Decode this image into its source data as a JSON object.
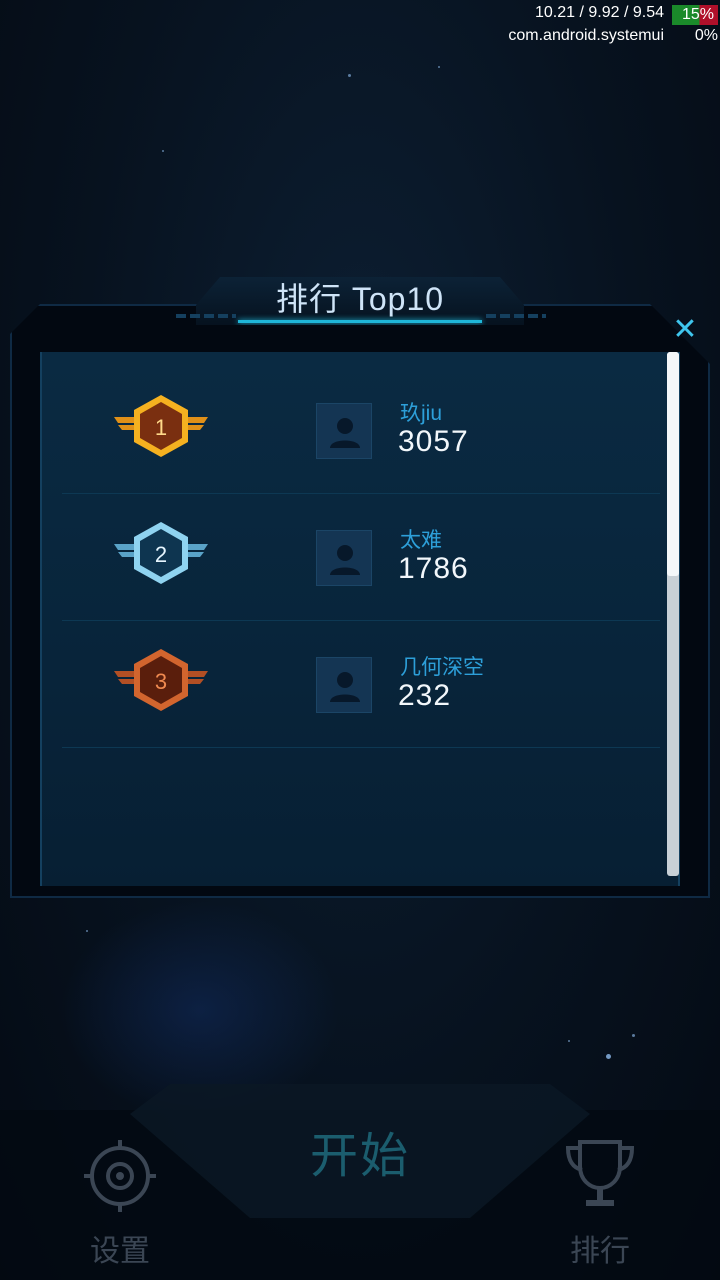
{
  "status_overlay": {
    "cpu_freqs": "10.21 / 9.92 / 9.54",
    "battery": "15%",
    "process": "com.android.systemui",
    "process_pct": "0%"
  },
  "leaderboard": {
    "title": "排行 Top10",
    "close_symbol": "✕",
    "entries": [
      {
        "rank": "1",
        "name": "玖jiu",
        "score": "3057",
        "medal_color": "#f2a41c"
      },
      {
        "rank": "2",
        "name": "太难",
        "score": "1786",
        "medal_color": "#7fc9ee"
      },
      {
        "rank": "3",
        "name": "几何深空",
        "score": "232",
        "medal_color": "#c2582a"
      }
    ]
  },
  "bottom_nav": {
    "settings_label": "设置",
    "start_label": "开始",
    "ranking_label": "排行"
  },
  "colors": {
    "accent": "#1fb6d9",
    "name_text": "#2d9fd9",
    "panel_bg": "#08243a"
  }
}
